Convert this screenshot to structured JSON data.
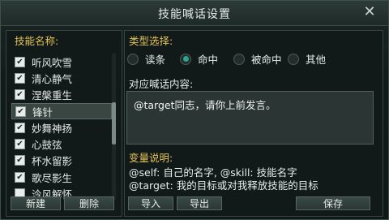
{
  "window": {
    "title": "技能喊话设置",
    "close_icon": "close-icon"
  },
  "left": {
    "title": "技能名称:",
    "skills": [
      {
        "label": "听风吹雪",
        "checked": true,
        "selected": false
      },
      {
        "label": "清心静气",
        "checked": true,
        "selected": false
      },
      {
        "label": "涅槃重生",
        "checked": true,
        "selected": false
      },
      {
        "label": "锋针",
        "checked": true,
        "selected": true
      },
      {
        "label": "妙舞神扬",
        "checked": true,
        "selected": false
      },
      {
        "label": "心鼓弦",
        "checked": true,
        "selected": false
      },
      {
        "label": "杯水留影",
        "checked": true,
        "selected": false
      },
      {
        "label": "歌尽影生",
        "checked": true,
        "selected": false
      },
      {
        "label": "泠风解怀",
        "checked": false,
        "selected": false
      }
    ],
    "new_label": "新建",
    "delete_label": "删除"
  },
  "right": {
    "type_label": "类型选择:",
    "types": [
      {
        "label": "读条",
        "selected": false
      },
      {
        "label": "命中",
        "selected": true
      },
      {
        "label": "被命中",
        "selected": false
      },
      {
        "label": "其他",
        "selected": false
      }
    ],
    "content_label": "对应喊话内容:",
    "content_value": "@target同志，请你上前发言。",
    "vars_label": "变量说明:",
    "var_line1": "@self: 自己的名字, @skill: 技能名字",
    "var_line2": "@target:  我的目标或对我释放技能的目标",
    "import_label": "导入",
    "export_label": "导出",
    "save_label": "保存"
  },
  "colors": {
    "gold": "#e0c25a",
    "accent": "#2aa58f"
  }
}
